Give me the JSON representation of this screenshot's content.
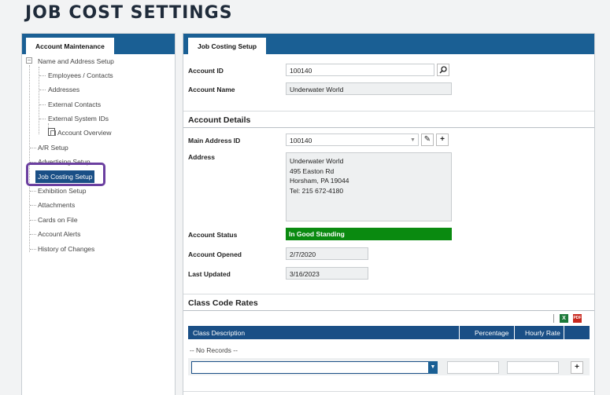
{
  "page": {
    "title": "JOB COST SETTINGS"
  },
  "left_panel": {
    "tab_label": "Account Maintenance",
    "tree": {
      "name_address_setup": "Name and Address Setup",
      "employees_contacts": "Employees / Contacts",
      "addresses": "Addresses",
      "external_contacts": "External Contacts",
      "external_system_ids": "External System IDs",
      "account_overview": "Account Overview",
      "ar_setup": "A/R Setup",
      "advertising_setup": "Advertising Setup",
      "job_costing_setup": "Job Costing Setup",
      "exhibition_setup": "Exhibition Setup",
      "attachments": "Attachments",
      "cards_on_file": "Cards on File",
      "account_alerts": "Account Alerts",
      "history_of_changes": "History of Changes"
    }
  },
  "right_panel": {
    "tab_label": "Job Costing Setup",
    "account_id_label": "Account ID",
    "account_id_value": "100140",
    "account_name_label": "Account Name",
    "account_name_value": "Underwater World",
    "account_details_title": "Account Details",
    "main_address_id_label": "Main Address ID",
    "main_address_id_value": "100140",
    "address_label": "Address",
    "address_lines": [
      "Underwater World",
      "495 Easton Rd",
      "Horsham, PA 19044",
      "Tel: 215 672-4180"
    ],
    "account_status_label": "Account Status",
    "account_status_value": "In Good Standing",
    "account_opened_label": "Account Opened",
    "account_opened_value": "2/7/2020",
    "last_updated_label": "Last Updated",
    "last_updated_value": "3/16/2023",
    "class_code_rates_title": "Class Code Rates",
    "grid_columns": [
      "Class Description",
      "Percentage",
      "Hourly Rate"
    ],
    "no_records": "-- No Records --"
  },
  "colors": {
    "header_blue": "#1a5f94",
    "grid_blue": "#1a4f86",
    "status_green": "#0a8a10",
    "highlight_ring": "#6b3fa0"
  }
}
